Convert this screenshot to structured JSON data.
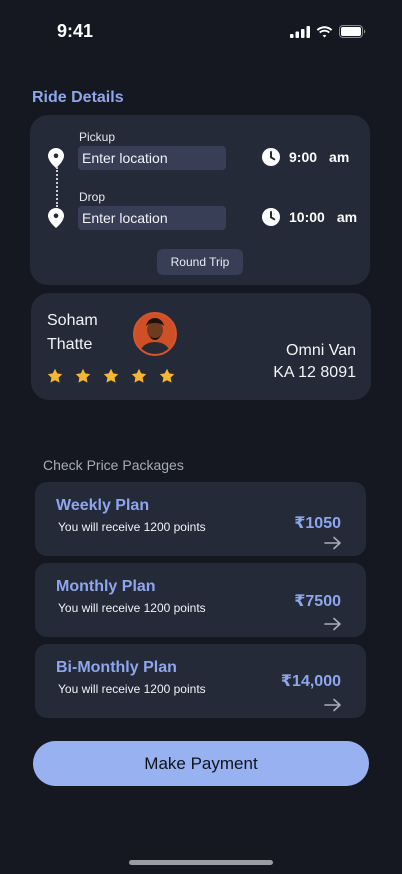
{
  "status_bar": {
    "time": "9:41"
  },
  "ride_details": {
    "title": "Ride Details",
    "pickup": {
      "label": "Pickup",
      "placeholder": "Enter location",
      "time": "9:00",
      "ampm": "am"
    },
    "drop": {
      "label": "Drop",
      "placeholder": "Enter location",
      "time": "10:00",
      "ampm": "am"
    },
    "round_trip_label": "Round Trip"
  },
  "driver": {
    "first_name": "Soham",
    "last_name": "Thatte",
    "rating": 5,
    "vehicle_model": "Omni Van",
    "vehicle_plate": "KA 12 8091"
  },
  "packages": {
    "title": "Check Price Packages",
    "plans": [
      {
        "name": "Weekly Plan",
        "description": "You will receive 1200 points",
        "price": "₹1050"
      },
      {
        "name": "Monthly Plan",
        "description": "You will receive 1200 points",
        "price": "₹7500"
      },
      {
        "name": "Bi-Monthly Plan",
        "description": "You will receive 1200 points",
        "price": "₹14,000"
      }
    ]
  },
  "actions": {
    "pay_label": "Make Payment"
  },
  "colors": {
    "background": "#151821",
    "card": "#252a39",
    "accent": "#8ea6ec",
    "button": "#98b1f0",
    "star": "#f5b731"
  }
}
